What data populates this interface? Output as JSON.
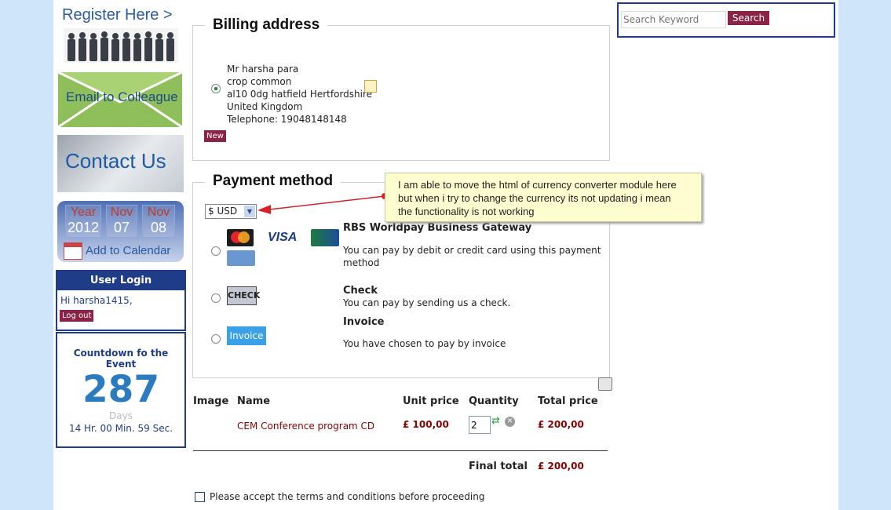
{
  "left": {
    "register_label": "Register Here >",
    "email_label": "Email to Colleague",
    "contact_label": "Contact Us",
    "calendar": {
      "year_label": "Year",
      "month_label": "Nov",
      "day_label": "Nov",
      "year": "2012",
      "month": "07",
      "day": "08",
      "add_label": "Add to Calendar"
    },
    "login": {
      "title": "User Login",
      "greeting": "Hi harsha1415,",
      "logout_label": "Log out"
    },
    "countdown": {
      "title": "Countdown fo the Event",
      "days": "287",
      "days_label": "Days",
      "time": "14 Hr. 00 Min. 59 Sec."
    }
  },
  "search": {
    "placeholder": "Search Keyword",
    "button_label": "Search"
  },
  "billing": {
    "title": "Billing address",
    "address_lines": [
      "Mr harsha para",
      "crop common",
      "al10 0dg hatfield Hertfordshire",
      "United Kingdom",
      "Telephone: 19048148148"
    ],
    "new_label": "New"
  },
  "payment": {
    "title": "Payment method",
    "currency": "$ USD",
    "methods": [
      {
        "title": "RBS Worldpay Business Gateway",
        "desc": "You can pay by debit or credit card using this payment method"
      },
      {
        "title": "Check",
        "desc": "You can pay by sending us a check.",
        "badge": "CHECK"
      },
      {
        "title": "Invoice",
        "desc": "You have chosen to pay by invoice",
        "badge": "Invoice"
      }
    ],
    "card_labels": {
      "mastercard": "MasterCard",
      "visa": "VISA",
      "amex": "AMERICAN EXPRESS",
      "cb": "CB"
    }
  },
  "note": {
    "text": "I am able to move the html of currency converter module here but when i try to change the currency its not updating i mean the functionality is not working"
  },
  "cart": {
    "headers": {
      "image": "Image",
      "name": "Name",
      "unit": "Unit price",
      "qty": "Quantity",
      "total": "Total price"
    },
    "item": {
      "name": "CEM Conference program CD",
      "unit": "£ 100,00",
      "qty": "2",
      "total": "£ 200,00"
    },
    "final_label": "Final total",
    "final_value": "£ 200,00"
  },
  "terms": "Please accept the terms and conditions before proceeding",
  "colors": {
    "background": "#cfe6fa",
    "maroon": "#8b2346",
    "navy": "#1f3c88",
    "price": "#8b0000"
  }
}
